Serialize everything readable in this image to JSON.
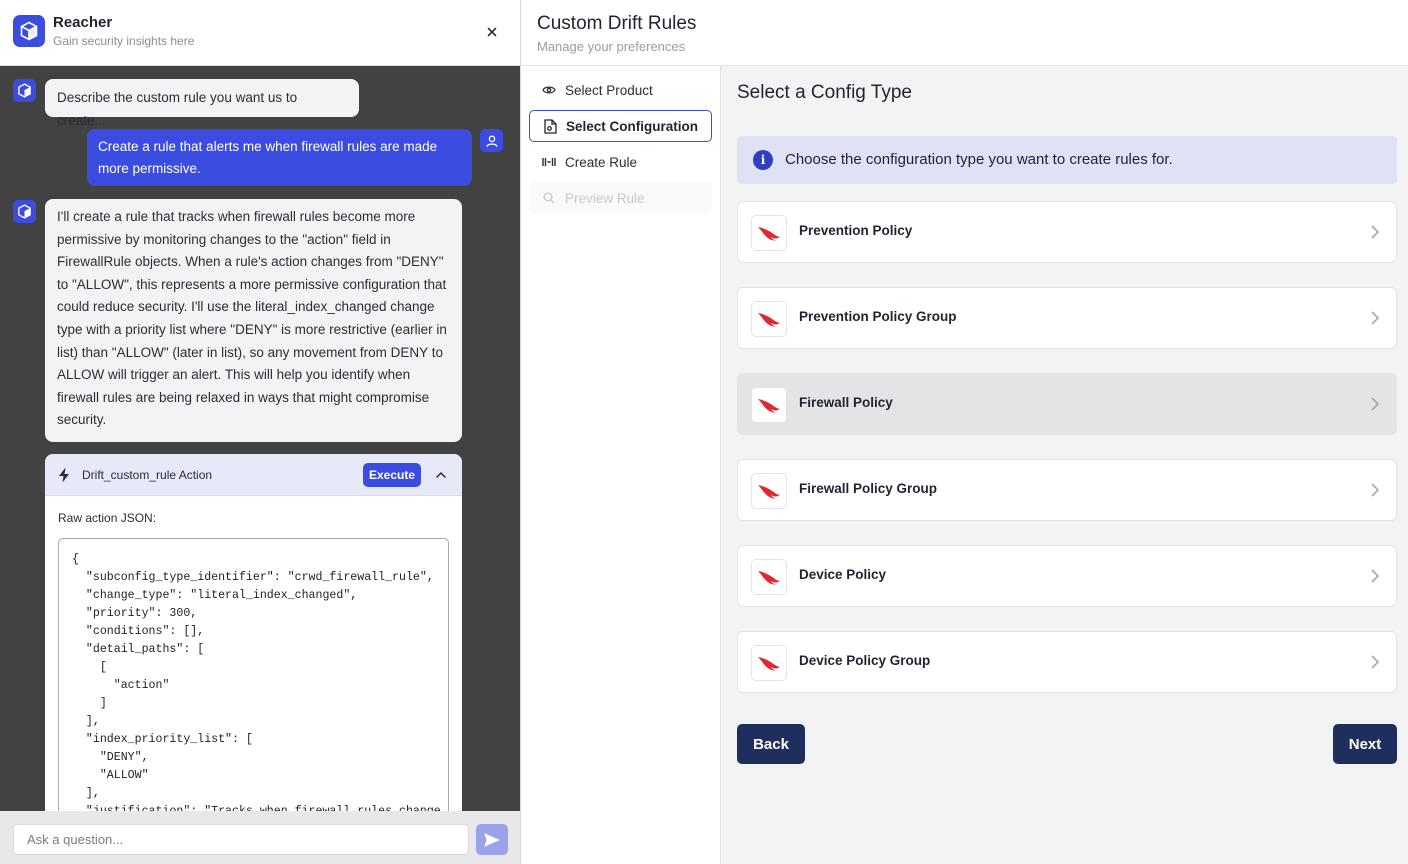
{
  "chat": {
    "brand_title": "Reacher",
    "brand_subtitle": "Gain security insights here",
    "messages": [
      {
        "role": "bot",
        "text": "Describe the custom rule you want us to create..."
      },
      {
        "role": "user",
        "text": "Create a rule that alerts me when firewall rules are made more permissive."
      },
      {
        "role": "bot",
        "text": "I'll create a rule that tracks when firewall rules become more permissive by monitoring changes to the \"action\" field in FirewallRule objects. When a rule's action changes from \"DENY\" to \"ALLOW\", this represents a more permissive configuration that could reduce security. I'll use the literal_index_changed change type with a priority list where \"DENY\" is more restrictive (earlier in list) than \"ALLOW\" (later in list), so any movement from DENY to ALLOW will trigger an alert. This will help you identify when firewall rules are being relaxed in ways that might compromise security."
      }
    ],
    "action": {
      "title": "Drift_custom_rule Action",
      "execute_label": "Execute",
      "raw_label": "Raw action JSON:",
      "json_text": "{\n  \"subconfig_type_identifier\": \"crwd_firewall_rule\",\n  \"change_type\": \"literal_index_changed\",\n  \"priority\": 300,\n  \"conditions\": [],\n  \"detail_paths\": [\n    [\n      \"action\"\n    ]\n  ],\n  \"index_priority_list\": [\n    \"DENY\",\n    \"ALLOW\"\n  ],\n  \"justification\": \"Tracks when firewall rules change fro"
    },
    "input_placeholder": "Ask a question..."
  },
  "main": {
    "title": "Custom Drift Rules",
    "subtitle": "Manage your preferences",
    "steps": [
      {
        "label": "Select Product",
        "state": "done",
        "icon": "eye-icon"
      },
      {
        "label": "Select Configuration",
        "state": "active",
        "icon": "file-settings-icon"
      },
      {
        "label": "Create Rule",
        "state": "pending",
        "icon": "code-icon"
      },
      {
        "label": "Preview Rule",
        "state": "disabled",
        "icon": "search-icon"
      }
    ],
    "section_title": "Select a Config Type",
    "info_text": "Choose the configuration type you want to create rules for.",
    "config_types": [
      {
        "name": "Prevention Policy",
        "hover": false
      },
      {
        "name": "Prevention Policy Group",
        "hover": false
      },
      {
        "name": "Firewall Policy",
        "hover": true
      },
      {
        "name": "Firewall Policy Group",
        "hover": false
      },
      {
        "name": "Device Policy",
        "hover": false
      },
      {
        "name": "Device Policy Group",
        "hover": false
      }
    ],
    "back_label": "Back",
    "next_label": "Next"
  },
  "colors": {
    "accent": "#3b4ce0",
    "navy": "#1e2f5e",
    "chat_bg": "#424242",
    "falcon_red": "#e0262f"
  }
}
